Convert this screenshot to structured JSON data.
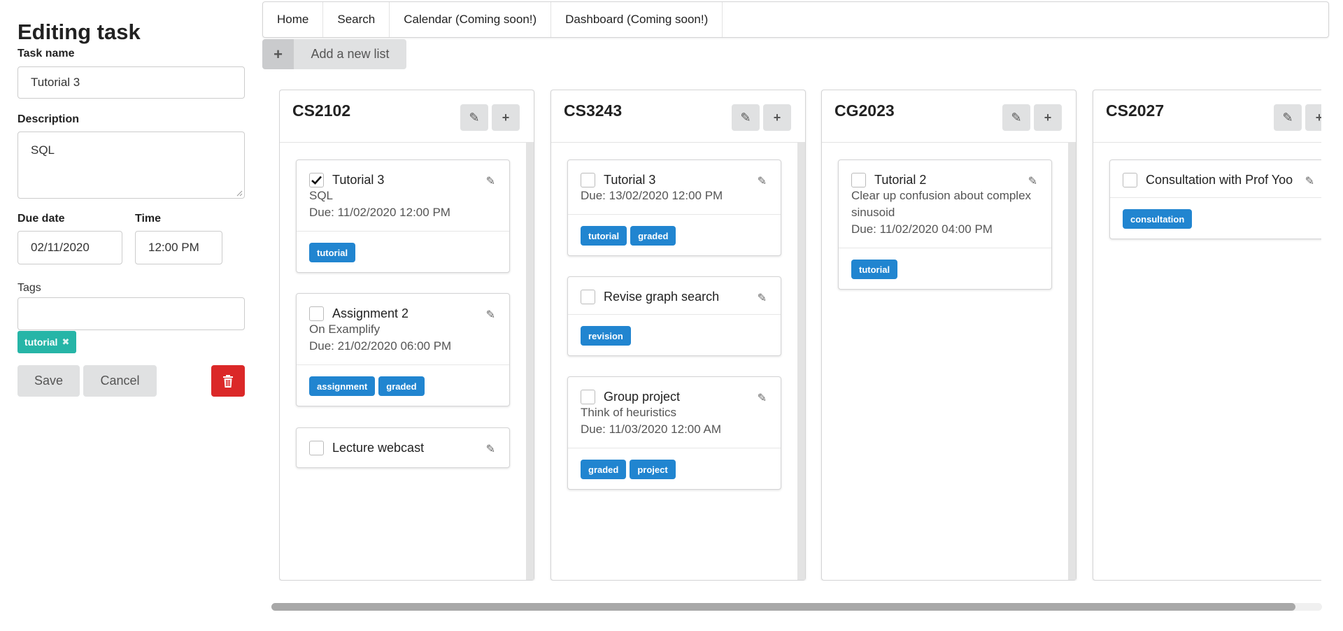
{
  "editor": {
    "title": "Editing task",
    "task_name_label": "Task name",
    "task_name_value": "Tutorial 3",
    "description_label": "Description",
    "description_value": "SQL",
    "due_date_label": "Due date",
    "due_date_value": "02/11/2020",
    "time_label": "Time",
    "time_value": "12:00 PM",
    "tags_label": "Tags",
    "tags_input_value": "",
    "selected_tags": [
      "tutorial"
    ],
    "save_label": "Save",
    "cancel_label": "Cancel",
    "delete_icon": "trash-icon"
  },
  "nav": {
    "items": [
      "Home",
      "Search",
      "Calendar (Coming soon!)",
      "Dashboard (Coming soon!)"
    ]
  },
  "add_list": {
    "icon": "plus-icon",
    "label": "Add a new list"
  },
  "lists": [
    {
      "title": "CS2102",
      "tasks": [
        {
          "title": "Tutorial 3",
          "checked": true,
          "desc": "SQL",
          "due": "Due: 11/02/2020 12:00 PM",
          "tags": [
            "tutorial"
          ]
        },
        {
          "title": "Assignment 2",
          "checked": false,
          "desc": "On Examplify",
          "due": "Due: 21/02/2020 06:00 PM",
          "tags": [
            "assignment",
            "graded"
          ]
        },
        {
          "title": "Lecture webcast",
          "checked": false,
          "desc": "",
          "due": "",
          "tags": []
        }
      ]
    },
    {
      "title": "CS3243",
      "tasks": [
        {
          "title": "Tutorial 3",
          "checked": false,
          "desc": "",
          "due": "Due: 13/02/2020 12:00 PM",
          "tags": [
            "tutorial",
            "graded"
          ]
        },
        {
          "title": "Revise graph search",
          "checked": false,
          "desc": "",
          "due": "",
          "tags": [
            "revision"
          ]
        },
        {
          "title": "Group project",
          "checked": false,
          "desc": "Think of heuristics",
          "due": "Due: 11/03/2020 12:00 AM",
          "tags": [
            "graded",
            "project"
          ]
        }
      ]
    },
    {
      "title": "CG2023",
      "tasks": [
        {
          "title": "Tutorial 2",
          "checked": false,
          "desc": "Clear up confusion about complex sinusoid",
          "due": "Due: 11/02/2020 04:00 PM",
          "tags": [
            "tutorial"
          ]
        }
      ]
    },
    {
      "title": "CS2027",
      "tasks": [
        {
          "title": "Consultation with Prof Yoo",
          "checked": false,
          "desc": "",
          "due": "",
          "tags": [
            "consultation"
          ]
        }
      ]
    }
  ],
  "colors": {
    "tag_blue": "#2185d0",
    "selected_tag_teal": "#26b5a7",
    "delete_red": "#db2828",
    "button_grey": "#e0e1e2"
  }
}
